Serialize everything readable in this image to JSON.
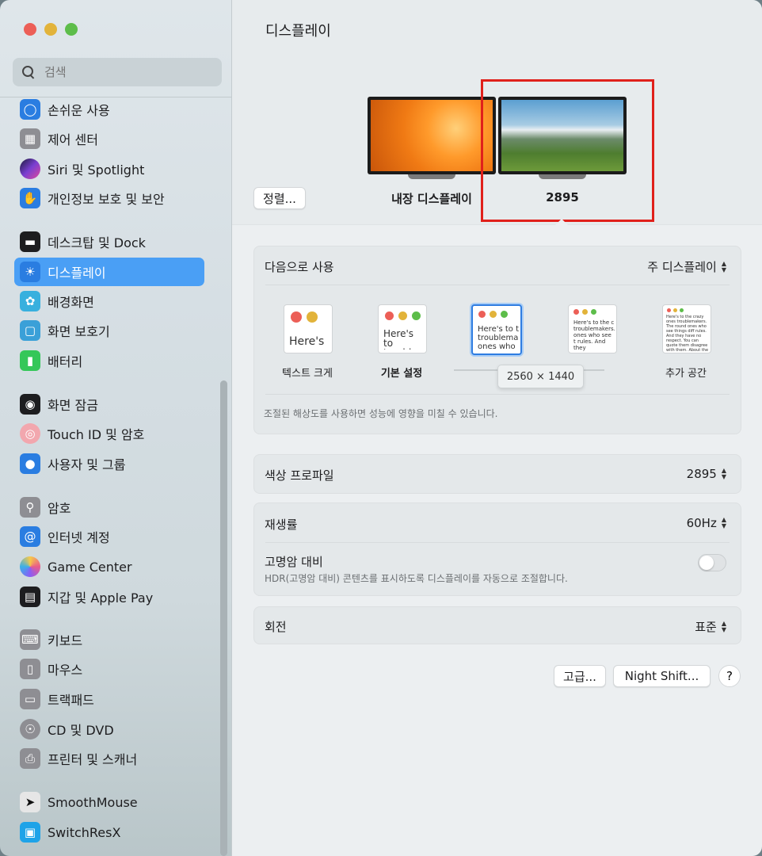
{
  "sidebar": {
    "search_placeholder": "검색",
    "items": [
      {
        "label": "손쉬운 사용",
        "icon": "accessibility-icon",
        "color": "#2a7de1"
      },
      {
        "label": "제어 센터",
        "icon": "control-center-icon",
        "color": "#8e8e93"
      },
      {
        "label": "Siri 및 Spotlight",
        "icon": "siri-icon",
        "color": "#5b3fb8"
      },
      {
        "label": "개인정보 보호 및 보안",
        "icon": "hand-icon",
        "color": "#2a7de1"
      },
      {
        "label": "데스크탑 및 Dock",
        "icon": "dock-icon",
        "color": "#1d1d1f"
      },
      {
        "label": "디스플레이",
        "icon": "display-sun-icon",
        "color": "#2a7de1",
        "selected": true
      },
      {
        "label": "배경화면",
        "icon": "wallpaper-flower-icon",
        "color": "#38b0de"
      },
      {
        "label": "화면 보호기",
        "icon": "screensaver-icon",
        "color": "#3aa0d8"
      },
      {
        "label": "배터리",
        "icon": "battery-icon",
        "color": "#34c759"
      },
      {
        "label": "화면 잠금",
        "icon": "lock-icon",
        "color": "#1d1d1f"
      },
      {
        "label": "Touch ID 및 암호",
        "icon": "fingerprint-icon",
        "color": "#f2a7ae"
      },
      {
        "label": "사용자 및 그룹",
        "icon": "users-icon",
        "color": "#2a7de1"
      },
      {
        "label": "암호",
        "icon": "key-icon",
        "color": "#8e8e93"
      },
      {
        "label": "인터넷 계정",
        "icon": "at-icon",
        "color": "#2a7de1"
      },
      {
        "label": "Game Center",
        "icon": "game-center-icon",
        "color": "#e95b8a"
      },
      {
        "label": "지갑 및 Apple Pay",
        "icon": "wallet-icon",
        "color": "#1d1d1f"
      },
      {
        "label": "키보드",
        "icon": "keyboard-icon",
        "color": "#8e8e93"
      },
      {
        "label": "마우스",
        "icon": "mouse-icon",
        "color": "#8e8e93"
      },
      {
        "label": "트랙패드",
        "icon": "trackpad-icon",
        "color": "#8e8e93"
      },
      {
        "label": "CD 및 DVD",
        "icon": "disc-icon",
        "color": "#8e8e93"
      },
      {
        "label": "프린터 및 스캐너",
        "icon": "printer-icon",
        "color": "#8e8e93"
      },
      {
        "label": "SmoothMouse",
        "icon": "cursor-icon",
        "color": "#e6e6e6"
      },
      {
        "label": "SwitchResX",
        "icon": "monitor-icon",
        "color": "#1fa3e8"
      }
    ]
  },
  "main": {
    "title": "디스플레이",
    "arrange_label": "정렬...",
    "displays": [
      {
        "label": "내장 디스플레이"
      },
      {
        "label": "2895"
      }
    ],
    "use_as": {
      "label": "다음으로 사용",
      "value": "주 디스플레이"
    },
    "resolution_options": [
      {
        "label": "텍스트 크게",
        "preview": "Here's"
      },
      {
        "label": "기본 설정",
        "preview": "Here's to troublem"
      },
      {
        "label": "",
        "preview": "Here's to t troublema ones who"
      },
      {
        "label": "",
        "preview": "Here's to the c troublemakers. ones who see t rules. And they"
      },
      {
        "label": "추가 공간",
        "preview": "Here's to the crazy ones troublemakers. The round ones who see things diff rules. And they have no respect. You can quote them disagree with them. About the only thing you can't change the world"
      }
    ],
    "resolution_tooltip": "2560 × 1440",
    "hint": "조절된 해상도를 사용하면 성능에 영향을 미칠 수 있습니다.",
    "color_profile": {
      "label": "색상 프로파일",
      "value": "2895"
    },
    "refresh_rate": {
      "label": "재생률",
      "value": "60Hz"
    },
    "hdr": {
      "label": "고명암 대비",
      "desc": "HDR(고명암 대비) 콘텐츠를 표시하도록 디스플레이를 자동으로 조절합니다.",
      "enabled": false
    },
    "rotation": {
      "label": "회전",
      "value": "표준"
    },
    "buttons": {
      "advanced": "고급...",
      "night_shift": "Night Shift...",
      "help": "?"
    }
  }
}
